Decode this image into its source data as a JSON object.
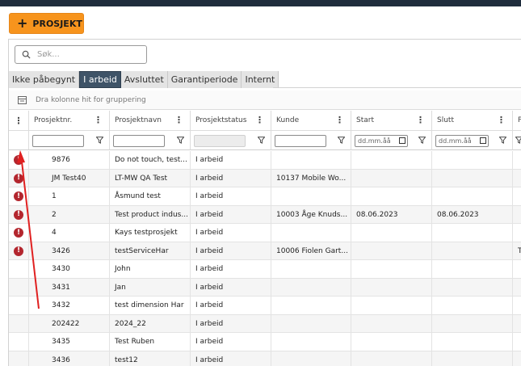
{
  "toolbar": {
    "new_project_label": "PROSJEKT"
  },
  "search": {
    "placeholder": "Søk..."
  },
  "tabs": [
    {
      "label": "Ikke påbegynt",
      "active": false
    },
    {
      "label": "I arbeid",
      "active": true
    },
    {
      "label": "Avsluttet",
      "active": false
    },
    {
      "label": "Garantiperiode",
      "active": false
    },
    {
      "label": "Internt",
      "active": false
    }
  ],
  "grouping": {
    "hint": "Dra kolonne hit for gruppering"
  },
  "columns": [
    {
      "label": "Prosjektnr."
    },
    {
      "label": "Prosjektnavn"
    },
    {
      "label": "Prosjektstatus"
    },
    {
      "label": "Kunde"
    },
    {
      "label": "Start"
    },
    {
      "label": "Slutt"
    },
    {
      "label": "P"
    }
  ],
  "filters": {
    "date_placeholder": "dd.mm.åå"
  },
  "rows": [
    {
      "error": true,
      "nr": "9876",
      "name": "Do not touch, test...",
      "status": "I arbeid",
      "customer": "",
      "start": "",
      "end": "",
      "extra": ""
    },
    {
      "error": true,
      "nr": "JM Test40",
      "name": "LT-MW QA Test",
      "status": "I arbeid",
      "customer": "10137 Mobile Wo...",
      "start": "",
      "end": "",
      "extra": ""
    },
    {
      "error": true,
      "nr": "1",
      "name": "Åsmund test",
      "status": "I arbeid",
      "customer": "",
      "start": "",
      "end": "",
      "extra": ""
    },
    {
      "error": true,
      "nr": "2",
      "name": "Test product indus...",
      "status": "I arbeid",
      "customer": "10003 Åge Knuds...",
      "start": "08.06.2023",
      "end": "08.06.2023",
      "extra": ""
    },
    {
      "error": true,
      "nr": "4",
      "name": "Kays testprosjekt",
      "status": "I arbeid",
      "customer": "",
      "start": "",
      "end": "",
      "extra": ""
    },
    {
      "error": true,
      "nr": "3426",
      "name": "testServiceHar",
      "status": "I arbeid",
      "customer": "10006 Fiolen Gart...",
      "start": "",
      "end": "",
      "extra": "T"
    },
    {
      "error": false,
      "nr": "3430",
      "name": "John",
      "status": "I arbeid",
      "customer": "",
      "start": "",
      "end": "",
      "extra": ""
    },
    {
      "error": false,
      "nr": "3431",
      "name": "Jan",
      "status": "I arbeid",
      "customer": "",
      "start": "",
      "end": "",
      "extra": ""
    },
    {
      "error": false,
      "nr": "3432",
      "name": "test dimension Har",
      "status": "I arbeid",
      "customer": "",
      "start": "",
      "end": "",
      "extra": ""
    },
    {
      "error": false,
      "nr": "202422",
      "name": "2024_22",
      "status": "I arbeid",
      "customer": "",
      "start": "",
      "end": "",
      "extra": ""
    },
    {
      "error": false,
      "nr": "3435",
      "name": "Test Ruben",
      "status": "I arbeid",
      "customer": "",
      "start": "",
      "end": "",
      "extra": ""
    },
    {
      "error": false,
      "nr": "3436",
      "name": "test12",
      "status": "I arbeid",
      "customer": "",
      "start": "",
      "end": "",
      "extra": ""
    }
  ],
  "colors": {
    "accent": "#f7941d",
    "tab_active": "#3f5468",
    "error": "#b3262e",
    "annotation": "#e02020"
  }
}
